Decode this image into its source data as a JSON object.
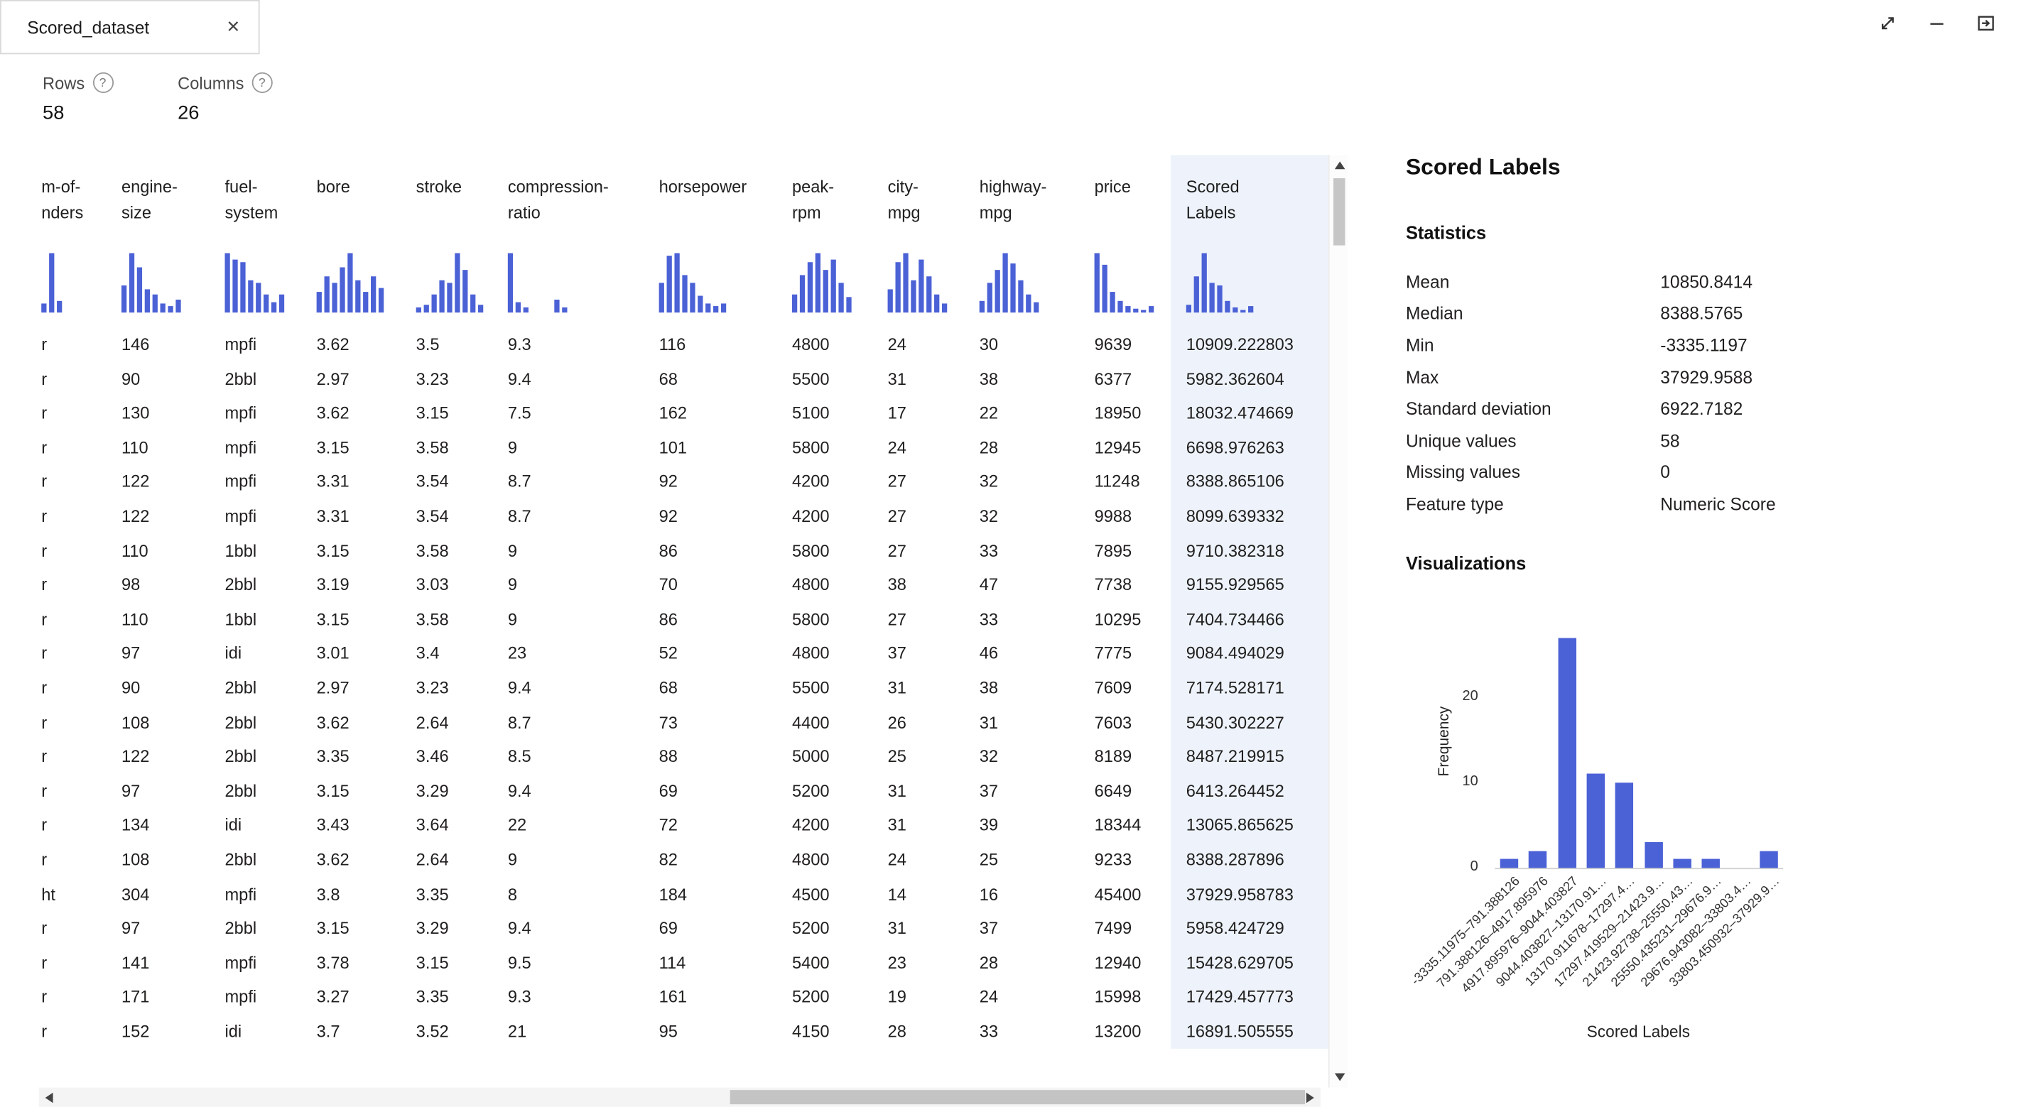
{
  "colors": {
    "accent": "#4b61d6",
    "column_highlight": "#eef3fb"
  },
  "window": {
    "tab_title": "Scored_dataset",
    "close_glyph": "✕"
  },
  "summary": {
    "rows_label": "Rows",
    "rows_value": "58",
    "columns_label": "Columns",
    "columns_value": "26",
    "help_glyph": "?"
  },
  "table": {
    "columns": [
      {
        "key": "num-of-cylinders",
        "label_lines": [
          "m-of-",
          "nders"
        ],
        "width": 86,
        "pad": 32,
        "sparkline": [
          0.15,
          1,
          0.2
        ]
      },
      {
        "key": "engine-size",
        "label_lines": [
          "engine-",
          "size"
        ],
        "width": 82,
        "pad": 8,
        "sparkline": [
          0.45,
          1,
          0.75,
          0.4,
          0.3,
          0.15,
          0.1,
          0.22
        ]
      },
      {
        "key": "fuel-system",
        "label_lines": [
          "fuel-",
          "system"
        ],
        "width": 70,
        "pad": 6,
        "sparkline": [
          1,
          0.9,
          0.85,
          0.55,
          0.5,
          0.3,
          0.18,
          0.3
        ]
      },
      {
        "key": "bore",
        "label_lines": [
          "bore"
        ],
        "width": 78,
        "pad": 7,
        "sparkline": [
          0.35,
          0.6,
          0.5,
          0.75,
          1,
          0.55,
          0.35,
          0.6,
          0.42
        ]
      },
      {
        "key": "stroke",
        "label_lines": [
          "stroke"
        ],
        "width": 70,
        "pad": 6,
        "sparkline": [
          0.08,
          0.12,
          0.3,
          0.55,
          0.5,
          1,
          0.72,
          0.3,
          0.12
        ]
      },
      {
        "key": "compression-ratio",
        "label_lines": [
          "compression-",
          "ratio"
        ],
        "width": 116,
        "pad": 7,
        "sparkline": [
          1,
          0.18,
          0.08,
          0,
          0,
          0,
          0.22,
          0.08
        ]
      },
      {
        "key": "horsepower",
        "label_lines": [
          "horsepower"
        ],
        "width": 104,
        "pad": 8,
        "sparkline": [
          0.5,
          0.95,
          1,
          0.62,
          0.5,
          0.28,
          0.15,
          0.1,
          0.15
        ]
      },
      {
        "key": "peak-rpm",
        "label_lines": [
          "peak-",
          "rpm"
        ],
        "width": 74,
        "pad": 7,
        "sparkline": [
          0.3,
          0.62,
          0.85,
          1,
          0.72,
          0.9,
          0.5,
          0.25
        ]
      },
      {
        "key": "city-mpg",
        "label_lines": [
          "city-",
          "mpg"
        ],
        "width": 72,
        "pad": 7,
        "sparkline": [
          0.4,
          0.85,
          1,
          0.55,
          0.9,
          0.6,
          0.3,
          0.15
        ]
      },
      {
        "key": "highway-mpg",
        "label_lines": [
          "highway-",
          "mpg"
        ],
        "width": 88,
        "pad": 6,
        "sparkline": [
          0.2,
          0.5,
          0.72,
          1,
          0.82,
          0.55,
          0.3,
          0.18
        ]
      },
      {
        "key": "price",
        "label_lines": [
          "price"
        ],
        "width": 66,
        "pad": 7,
        "sparkline": [
          1,
          0.8,
          0.35,
          0.2,
          0.1,
          0.06,
          0.05,
          0.1
        ]
      },
      {
        "key": "scored-labels",
        "label_lines": [
          "Scored",
          "Labels"
        ],
        "width": 122,
        "pad": 12,
        "highlight": true,
        "sparkline": [
          0.12,
          0.6,
          1,
          0.5,
          0.45,
          0.2,
          0.08,
          0.05,
          0.1
        ]
      }
    ],
    "rows": [
      [
        "r",
        "146",
        "mpfi",
        "3.62",
        "3.5",
        "9.3",
        "116",
        "4800",
        "24",
        "30",
        "9639",
        "10909.222803"
      ],
      [
        "r",
        "90",
        "2bbl",
        "2.97",
        "3.23",
        "9.4",
        "68",
        "5500",
        "31",
        "38",
        "6377",
        "5982.362604"
      ],
      [
        "r",
        "130",
        "mpfi",
        "3.62",
        "3.15",
        "7.5",
        "162",
        "5100",
        "17",
        "22",
        "18950",
        "18032.474669"
      ],
      [
        "r",
        "110",
        "mpfi",
        "3.15",
        "3.58",
        "9",
        "101",
        "5800",
        "24",
        "28",
        "12945",
        "6698.976263"
      ],
      [
        "r",
        "122",
        "mpfi",
        "3.31",
        "3.54",
        "8.7",
        "92",
        "4200",
        "27",
        "32",
        "11248",
        "8388.865106"
      ],
      [
        "r",
        "122",
        "mpfi",
        "3.31",
        "3.54",
        "8.7",
        "92",
        "4200",
        "27",
        "32",
        "9988",
        "8099.639332"
      ],
      [
        "r",
        "110",
        "1bbl",
        "3.15",
        "3.58",
        "9",
        "86",
        "5800",
        "27",
        "33",
        "7895",
        "9710.382318"
      ],
      [
        "r",
        "98",
        "2bbl",
        "3.19",
        "3.03",
        "9",
        "70",
        "4800",
        "38",
        "47",
        "7738",
        "9155.929565"
      ],
      [
        "r",
        "110",
        "1bbl",
        "3.15",
        "3.58",
        "9",
        "86",
        "5800",
        "27",
        "33",
        "10295",
        "7404.734466"
      ],
      [
        "r",
        "97",
        "idi",
        "3.01",
        "3.4",
        "23",
        "52",
        "4800",
        "37",
        "46",
        "7775",
        "9084.494029"
      ],
      [
        "r",
        "90",
        "2bbl",
        "2.97",
        "3.23",
        "9.4",
        "68",
        "5500",
        "31",
        "38",
        "7609",
        "7174.528171"
      ],
      [
        "r",
        "108",
        "2bbl",
        "3.62",
        "2.64",
        "8.7",
        "73",
        "4400",
        "26",
        "31",
        "7603",
        "5430.302227"
      ],
      [
        "r",
        "122",
        "2bbl",
        "3.35",
        "3.46",
        "8.5",
        "88",
        "5000",
        "25",
        "32",
        "8189",
        "8487.219915"
      ],
      [
        "r",
        "97",
        "2bbl",
        "3.15",
        "3.29",
        "9.4",
        "69",
        "5200",
        "31",
        "37",
        "6649",
        "6413.264452"
      ],
      [
        "r",
        "134",
        "idi",
        "3.43",
        "3.64",
        "22",
        "72",
        "4200",
        "31",
        "39",
        "18344",
        "13065.865625"
      ],
      [
        "r",
        "108",
        "2bbl",
        "3.62",
        "2.64",
        "9",
        "82",
        "4800",
        "24",
        "25",
        "9233",
        "8388.287896"
      ],
      [
        "ht",
        "304",
        "mpfi",
        "3.8",
        "3.35",
        "8",
        "184",
        "4500",
        "14",
        "16",
        "45400",
        "37929.958783"
      ],
      [
        "r",
        "97",
        "2bbl",
        "3.15",
        "3.29",
        "9.4",
        "69",
        "5200",
        "31",
        "37",
        "7499",
        "5958.424729"
      ],
      [
        "r",
        "141",
        "mpfi",
        "3.78",
        "3.15",
        "9.5",
        "114",
        "5400",
        "23",
        "28",
        "12940",
        "15428.629705"
      ],
      [
        "r",
        "171",
        "mpfi",
        "3.27",
        "3.35",
        "9.3",
        "161",
        "5200",
        "19",
        "24",
        "15998",
        "17429.457773"
      ],
      [
        "r",
        "152",
        "idi",
        "3.7",
        "3.52",
        "21",
        "95",
        "4150",
        "28",
        "33",
        "13200",
        "16891.505555"
      ]
    ]
  },
  "panel": {
    "title": "Scored Labels",
    "statistics_heading": "Statistics",
    "stats": [
      {
        "label": "Mean",
        "value": "10850.8414"
      },
      {
        "label": "Median",
        "value": "8388.5765"
      },
      {
        "label": "Min",
        "value": "-3335.1197"
      },
      {
        "label": "Max",
        "value": "37929.9588"
      },
      {
        "label": "Standard deviation",
        "value": "6922.7182"
      },
      {
        "label": "Unique values",
        "value": "58"
      },
      {
        "label": "Missing values",
        "value": "0"
      },
      {
        "label": "Feature type",
        "value": "Numeric Score"
      }
    ],
    "visualizations_heading": "Visualizations"
  },
  "chart_data": {
    "type": "bar",
    "title": "",
    "xlabel": "Scored Labels",
    "ylabel": "Frequency",
    "ylim": [
      0,
      28
    ],
    "yticks": [
      0,
      10,
      20
    ],
    "grid": false,
    "legend": false,
    "categories": [
      "-3335.11975–791.388126",
      "791.388126–4917.895976",
      "4917.895976–9044.403827",
      "9044.403827–13170.91…",
      "13170.911678–17297.4…",
      "17297.419529–21423.9…",
      "21423.92738–25550.43…",
      "25550.435231–29676.9…",
      "29676.943082–33803.4…",
      "33803.450932–37929.9…"
    ],
    "values": [
      1,
      2,
      27,
      11,
      10,
      3,
      1,
      1,
      0,
      2
    ]
  }
}
